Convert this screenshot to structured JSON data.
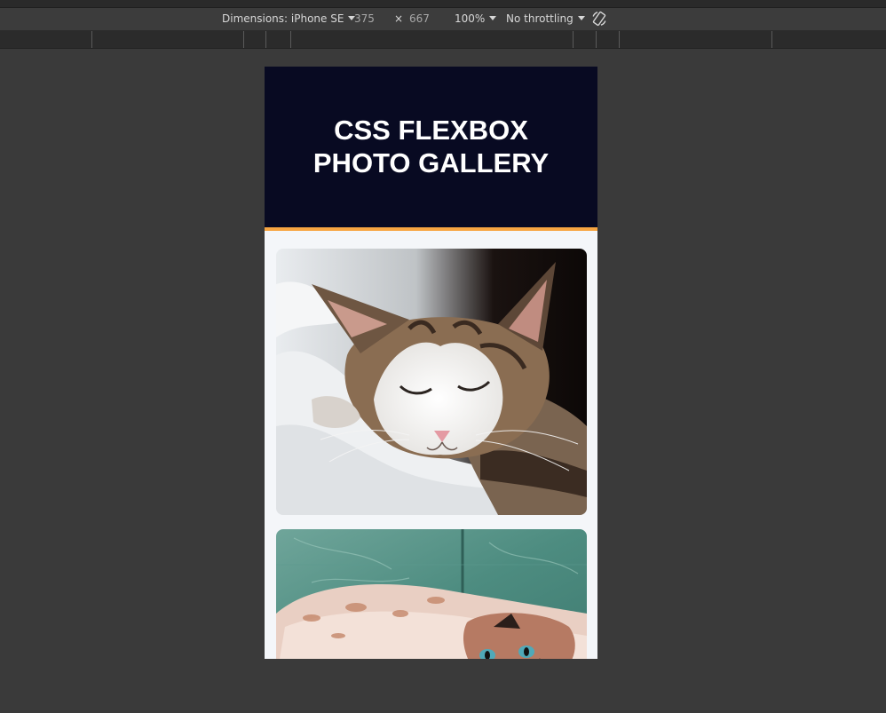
{
  "devtools": {
    "dimensions_label": "Dimensions: iPhone SE",
    "width_value": "375",
    "times_symbol": "×",
    "height_value": "667",
    "zoom_label": "100%",
    "throttling_label": "No throttling",
    "rotate_icon": "rotate-device-icon"
  },
  "page": {
    "title_line1": "CSS FLEXBOX",
    "title_line2": "PHOTO GALLERY",
    "header_bg": "#080a22",
    "accent": "#f7a542"
  },
  "gallery": {
    "photos": [
      {
        "subject": "sleeping-tabby-cat"
      },
      {
        "subject": "cat-lying-on-back"
      }
    ]
  }
}
